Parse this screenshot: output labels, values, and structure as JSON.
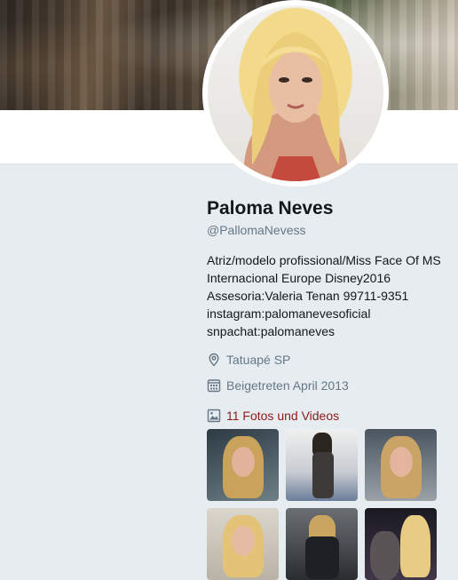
{
  "profile": {
    "name": "Paloma Neves",
    "handle": "@PallomaNevess",
    "bio_lines": [
      "Atriz/modelo profissional/Miss Face Of MS",
      "Internacional Europe Disney2016",
      "Assesoria:Valeria Tenan 99711-9351",
      "instagram:palomanevesoficial",
      "snpachat:palomaneves"
    ],
    "location": "Tatuapé SP",
    "joined": "Beigetreten April 2013"
  },
  "media": {
    "label": "11 Fotos und Videos",
    "thumbnail_count": 6
  },
  "icons": {
    "location": "location-pin-icon",
    "joined": "calendar-icon",
    "media": "image-icon"
  },
  "colors": {
    "page_background": "#e6ecf0",
    "secondary_text": "#657786",
    "media_link": "#8b1a1a"
  }
}
